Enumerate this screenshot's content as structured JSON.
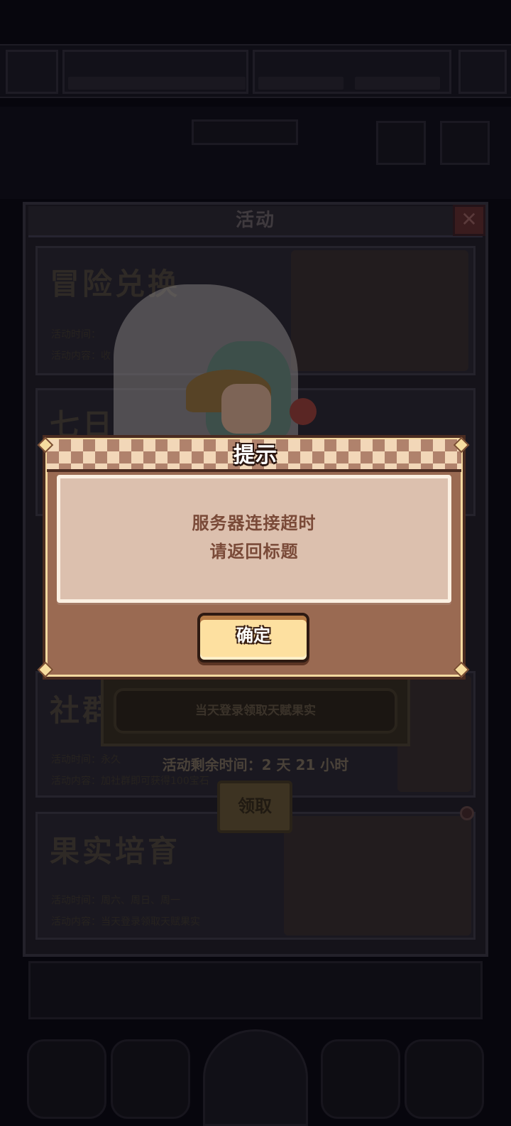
{
  "activity_panel": {
    "title": "活动",
    "close_icon": "close-icon",
    "cards": [
      {
        "title": "冒险兑换",
        "time_label": "活动时间：",
        "content_label": "活动内容：收"
      },
      {
        "title": "七日"
      },
      {
        "title": "社群",
        "time_label": "活动时间：永久",
        "content_label": "活动内容：加社群即可获得100宝石"
      },
      {
        "title": "果实培育",
        "time_label": "活动时间：周六、周日、周一",
        "content_label": "活动内容：当天登录领取天赋果实"
      }
    ],
    "reward": {
      "description": "当天登录领取天赋果实",
      "remaining_time": "活动剩余时间：2 天 21 小时",
      "claim_label": "领取"
    }
  },
  "dialog": {
    "title": "提示",
    "message_line1": "服务器连接超时",
    "message_line2": "请返回标题",
    "confirm_label": "确定"
  },
  "colors": {
    "dialog_body": "#9a6a52",
    "dialog_message_bg": "#dcc0ae",
    "message_text": "#7a4a38",
    "confirm_button": "#fde0a0",
    "background": "#07060d"
  }
}
